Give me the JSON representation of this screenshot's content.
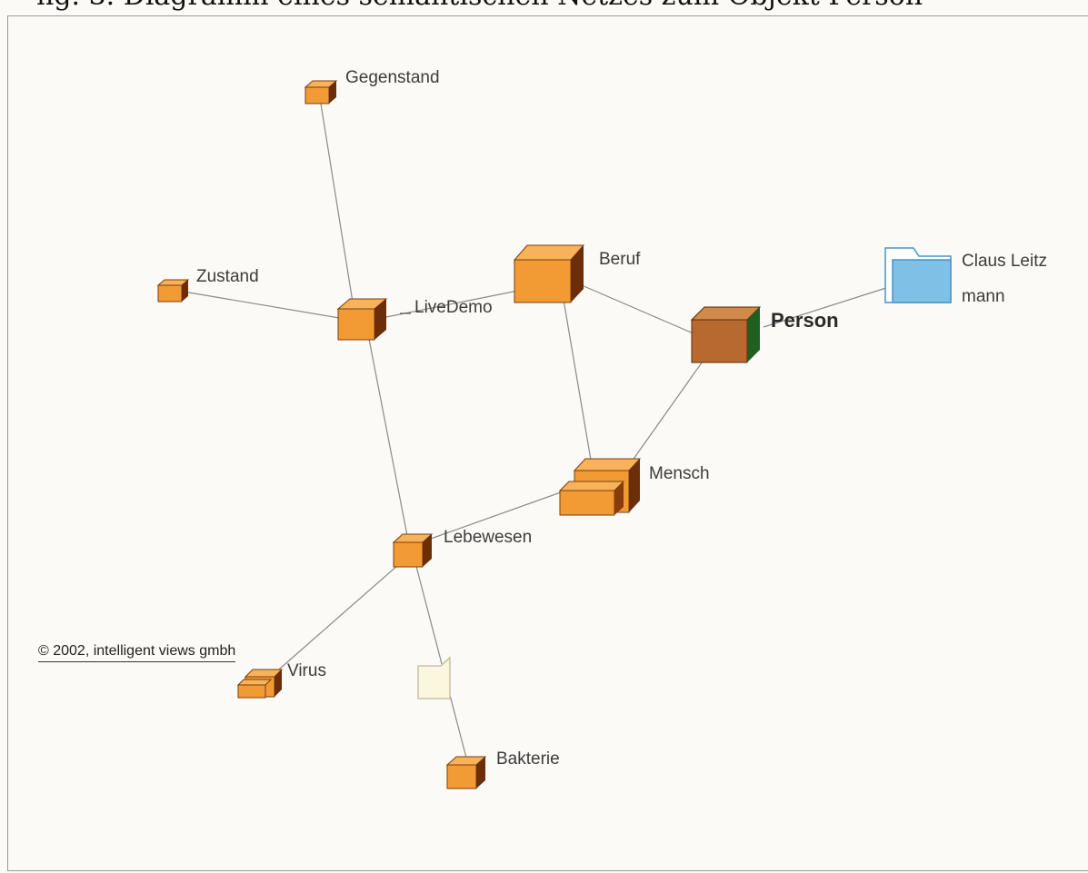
{
  "header_fragment": "ng. 3. Diagramm eines semantischen Netzes zum Objekt Person",
  "nodes": {
    "gegenstand": "Gegenstand",
    "zustand": "Zustand",
    "livedemo": "LiveDemo",
    "beruf": "Beruf",
    "person": "Person",
    "claus_line1": "Claus Leitz",
    "claus_line2": "mann",
    "mensch": "Mensch",
    "lebewesen": "Lebewesen",
    "virus": "Virus",
    "bakterie": "Bakterie"
  },
  "copyright": "© 2002, intelligent views gmbh",
  "colors": {
    "cube_orange": "#f29a34",
    "cube_brown": "#b8692f",
    "folder_blue": "#7fc0e6",
    "document_cream": "#fbf6dd",
    "edge": "#8a8a8a"
  }
}
